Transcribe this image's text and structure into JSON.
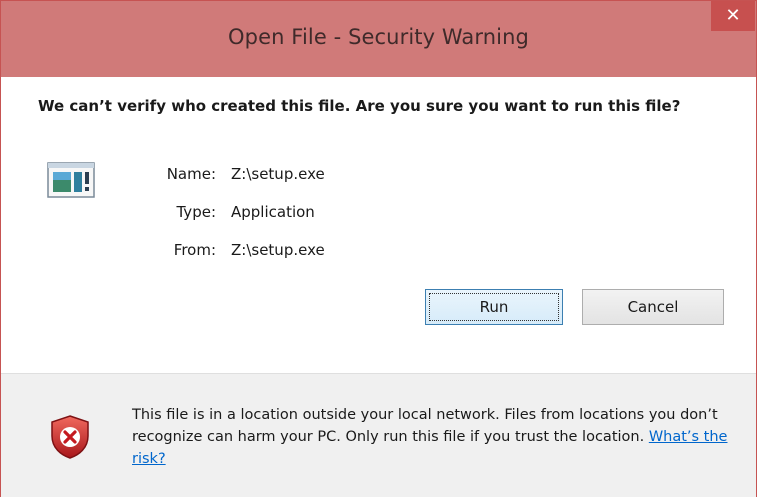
{
  "window": {
    "title": "Open File - Security Warning",
    "close_glyph": "✕",
    "accent_color": "#d07a79",
    "close_color": "#c7504f"
  },
  "dialog": {
    "question": "We can’t verify who created this file. Are you sure you want to run this file?",
    "app_icon": "application-icon",
    "details": [
      {
        "label": "Name:",
        "value": "Z:\\setup.exe"
      },
      {
        "label": "Type:",
        "value": "Application"
      },
      {
        "label": "From:",
        "value": "Z:\\setup.exe"
      }
    ],
    "buttons": {
      "run_label": "Run",
      "cancel_label": "Cancel"
    }
  },
  "footer": {
    "shield_icon": "security-shield-icon",
    "warning_text": "This file is in a location outside your local network. Files from locations you don’t recognize can harm your PC. Only run this file if you trust the location.",
    "link_text": "What’s the risk?"
  }
}
